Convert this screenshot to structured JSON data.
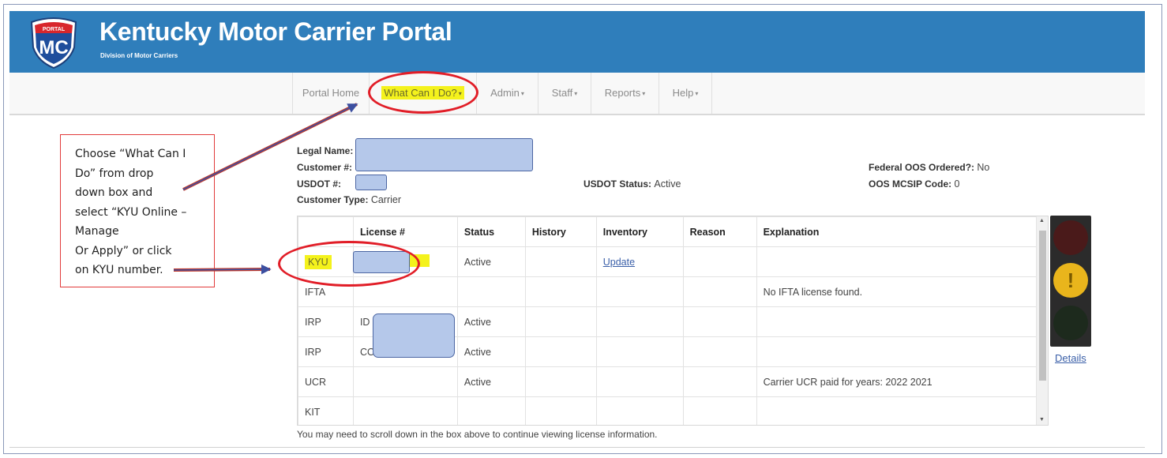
{
  "header": {
    "logo_text_top": "PORTAL",
    "logo_text": "MC",
    "title": "Kentucky Motor Carrier Portal",
    "subtitle": "Division of Motor Carriers"
  },
  "nav": {
    "items": [
      {
        "label": "Portal Home",
        "dropdown": false
      },
      {
        "label": "What Can I Do?",
        "dropdown": true
      },
      {
        "label": "Admin",
        "dropdown": true
      },
      {
        "label": "Staff",
        "dropdown": true
      },
      {
        "label": "Reports",
        "dropdown": true
      },
      {
        "label": "Help",
        "dropdown": true
      }
    ],
    "caret": "▾"
  },
  "callout": {
    "lines": [
      "Choose “What Can I",
      "Do” from drop",
      "down box and",
      "select “KYU Online –",
      "Manage",
      "Or Apply” or  click",
      "on KYU number."
    ]
  },
  "info": {
    "legal_name_label": "Legal Name:",
    "customer_label": "Customer #:",
    "usdot_label": "USDOT #:",
    "customer_type_label": "Customer Type:",
    "customer_type_value": "Carrier",
    "usdot_status_label": "USDOT Status:",
    "usdot_status_value": "Active",
    "federal_oos_label": "Federal OOS Ordered?:",
    "federal_oos_value": "No",
    "oos_mcsip_label": "OOS MCSIP Code:",
    "oos_mcsip_value": "0"
  },
  "table": {
    "headers": [
      "",
      "License #",
      "Status",
      "History",
      "Inventory",
      "Reason",
      "Explanation"
    ],
    "rows": [
      {
        "type": "KYU",
        "license": "",
        "status": "Active",
        "history": "",
        "inventory": "Update",
        "reason": "",
        "explanation": ""
      },
      {
        "type": "IFTA",
        "license": "",
        "status": "",
        "history": "",
        "inventory": "",
        "reason": "",
        "explanation": "No IFTA license found."
      },
      {
        "type": "IRP",
        "license": "ID",
        "status": "Active",
        "history": "",
        "inventory": "",
        "reason": "",
        "explanation": ""
      },
      {
        "type": "IRP",
        "license": "CO",
        "status": "Active",
        "history": "",
        "inventory": "",
        "reason": "",
        "explanation": ""
      },
      {
        "type": "UCR",
        "license": "",
        "status": "Active",
        "history": "",
        "inventory": "",
        "reason": "",
        "explanation": "Carrier UCR paid for years: 2022 2021"
      },
      {
        "type": "KIT",
        "license": "",
        "status": "",
        "history": "",
        "inventory": "",
        "reason": "",
        "explanation": ""
      }
    ],
    "footnote": "You may need to scroll down in the box above to continue viewing license information."
  },
  "status_light": {
    "warning_symbol": "!",
    "details_label": "Details",
    "colors": {
      "red_off": "#4a1a1a",
      "yellow_on": "#e9b51c",
      "green_off": "#1d2a1d"
    }
  },
  "colors": {
    "header_bg": "#2f7ebb",
    "highlight": "#f4f21c",
    "annotation_red": "#e11d27"
  }
}
